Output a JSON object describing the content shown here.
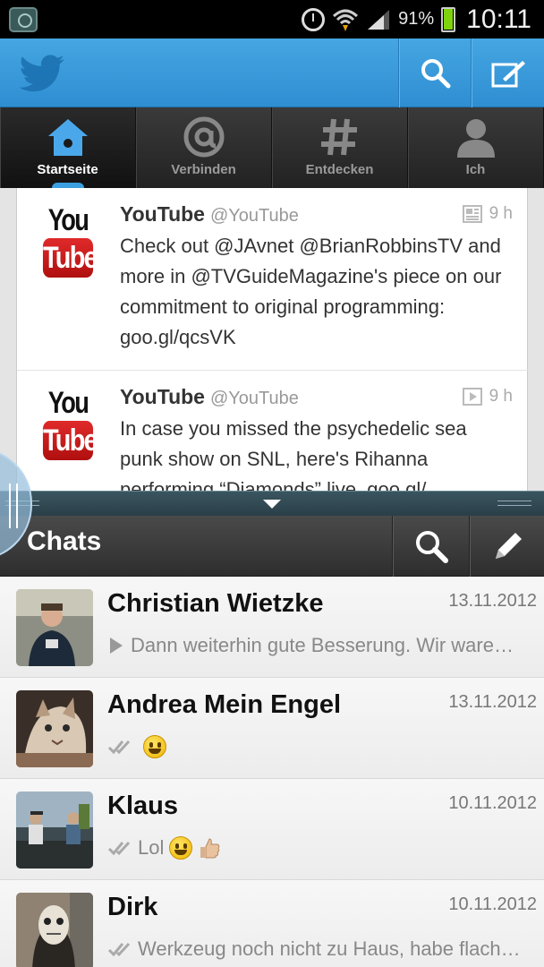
{
  "status_bar": {
    "battery_percent": "91%",
    "battery_level": 0.91,
    "time": "10:11",
    "icons": [
      "app-shield-icon",
      "alarm-icon",
      "wifi-icon",
      "signal-icon",
      "battery-icon"
    ]
  },
  "twitter": {
    "accent": "#3a9ad9",
    "header_icons": [
      "twitter-bird-icon",
      "search-icon",
      "compose-icon"
    ],
    "tabs": [
      {
        "label": "Startseite",
        "icon": "home-icon"
      },
      {
        "label": "Verbinden",
        "icon": "at-icon"
      },
      {
        "label": "Entdecken",
        "icon": "hash-icon"
      },
      {
        "label": "Ich",
        "icon": "person-icon"
      }
    ],
    "tweets": [
      {
        "name": "YouTube",
        "handle": "@YouTube",
        "time": "9 h",
        "logo_top": "You",
        "logo_bottom": "Tube",
        "text": "Check out @JAvnet @BrianRobbinsTV and more in @TVGuideMagazine's piece on our commitment to original programming: goo.gl/qcsVK"
      },
      {
        "name": "YouTube",
        "handle": "@YouTube",
        "time": "9 h",
        "logo_top": "You",
        "logo_bottom": "Tube",
        "text": "In case you missed the psychedelic sea punk show on SNL, here's Rihanna performing “Diamonds” live. goo.gl/"
      }
    ]
  },
  "whatsapp": {
    "title": "Chats",
    "chats": [
      {
        "name": "Christian Wietzke",
        "date": "13.11.2012",
        "preview": "Dann weiterhin gute Besserung. Wir ware…"
      },
      {
        "name": "Andrea Mein Engel",
        "date": "13.11.2012",
        "preview": ""
      },
      {
        "name": "Klaus",
        "date": "10.11.2012",
        "preview": "Lol"
      },
      {
        "name": "Dirk",
        "date": "10.11.2012",
        "preview": "Werkzeug noch nicht zu Haus, habe flach…"
      }
    ]
  }
}
